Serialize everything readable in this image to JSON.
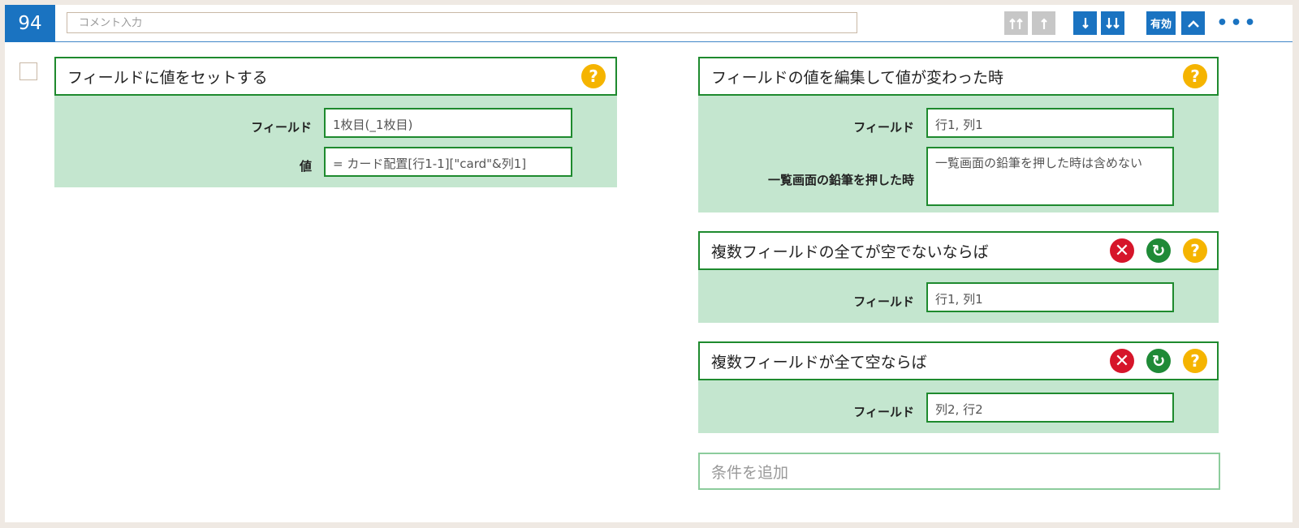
{
  "rule": {
    "number": "94",
    "comment_placeholder": "コメント入力",
    "enabled_label": "有効",
    "more_label": "•••"
  },
  "toolbar": {
    "buttons": [
      {
        "name": "move-top-icon",
        "state": "disabled"
      },
      {
        "name": "move-up-icon",
        "state": "disabled"
      },
      {
        "name": "move-down-icon",
        "state": "active"
      },
      {
        "name": "move-bottom-icon",
        "state": "active"
      },
      {
        "name": "enabled-toggle",
        "state": "active"
      },
      {
        "name": "collapse-icon",
        "state": "active"
      }
    ]
  },
  "action": {
    "title": "フィールドに値をセットする",
    "fields": [
      {
        "label": "フィールド",
        "value": "1枚目(_1枚目)"
      },
      {
        "label": "値",
        "value": "= カード配置[行1-1][\"card\"&列1]"
      }
    ]
  },
  "conditions": [
    {
      "title": "フィールドの値を編集して値が変わった時",
      "fields": [
        {
          "label": "フィールド",
          "value": "行1, 列1"
        },
        {
          "label": "一覧画面の鉛筆を押した時",
          "value": "一覧画面の鉛筆を押した時は含めない"
        }
      ]
    },
    {
      "title": "複数フィールドの全てが空でないならば",
      "fields": [
        {
          "label": "フィールド",
          "value": "行1, 列1"
        }
      ]
    },
    {
      "title": "複数フィールドが全て空ならば",
      "fields": [
        {
          "label": "フィールド",
          "value": "列2, 行2"
        }
      ]
    }
  ],
  "add_condition_placeholder": "条件を追加",
  "icons": {
    "help": "?",
    "delete": "✕",
    "refresh": "↻"
  },
  "colors": {
    "accent_blue": "#1a73c1",
    "block_green_bg": "#c4e6cf",
    "border_green": "#1e8a2e",
    "help_yellow": "#f5b400",
    "delete_red": "#d6152a",
    "refresh_green": "#1f8a37"
  }
}
